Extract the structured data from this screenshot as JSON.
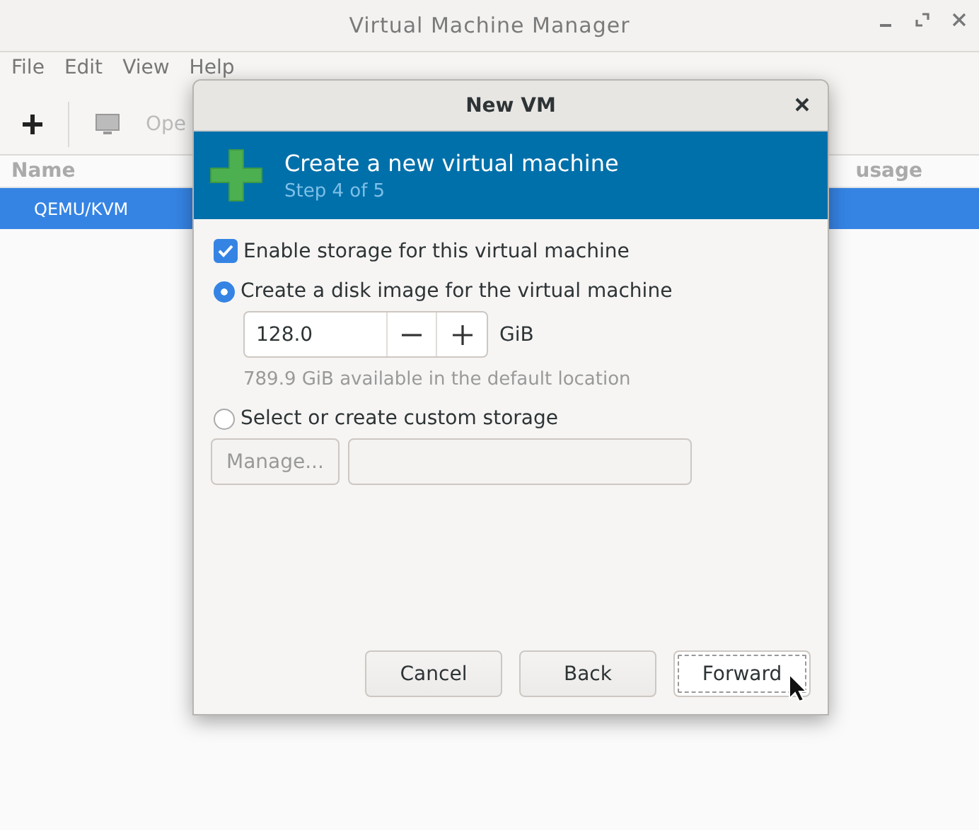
{
  "window": {
    "title": "Virtual Machine Manager"
  },
  "menu": [
    {
      "label": "File"
    },
    {
      "label": "Edit"
    },
    {
      "label": "View"
    },
    {
      "label": "Help"
    }
  ],
  "toolbar": {
    "open_label": "Ope"
  },
  "table": {
    "columns": [
      "Name",
      "usage"
    ],
    "rows": [
      {
        "name": "QEMU/KVM",
        "selected": true
      }
    ]
  },
  "dialog": {
    "title": "New VM",
    "banner": {
      "title": "Create a new virtual machine",
      "step": "Step 4 of 5"
    },
    "enable_storage": {
      "label": "Enable storage for this virtual machine",
      "checked": true
    },
    "options": [
      {
        "label": "Create a disk image for the virtual machine",
        "selected": true
      },
      {
        "label": "Select or create custom storage",
        "selected": false
      }
    ],
    "size": {
      "value": "128.0",
      "unit": "GiB",
      "hint": "789.9 GiB available in the default location"
    },
    "manage": {
      "label": "Manage...",
      "disabled": true
    },
    "buttons": [
      {
        "label": "Cancel",
        "focused": false
      },
      {
        "label": "Back",
        "focused": false
      },
      {
        "label": "Forward",
        "focused": true
      }
    ]
  }
}
